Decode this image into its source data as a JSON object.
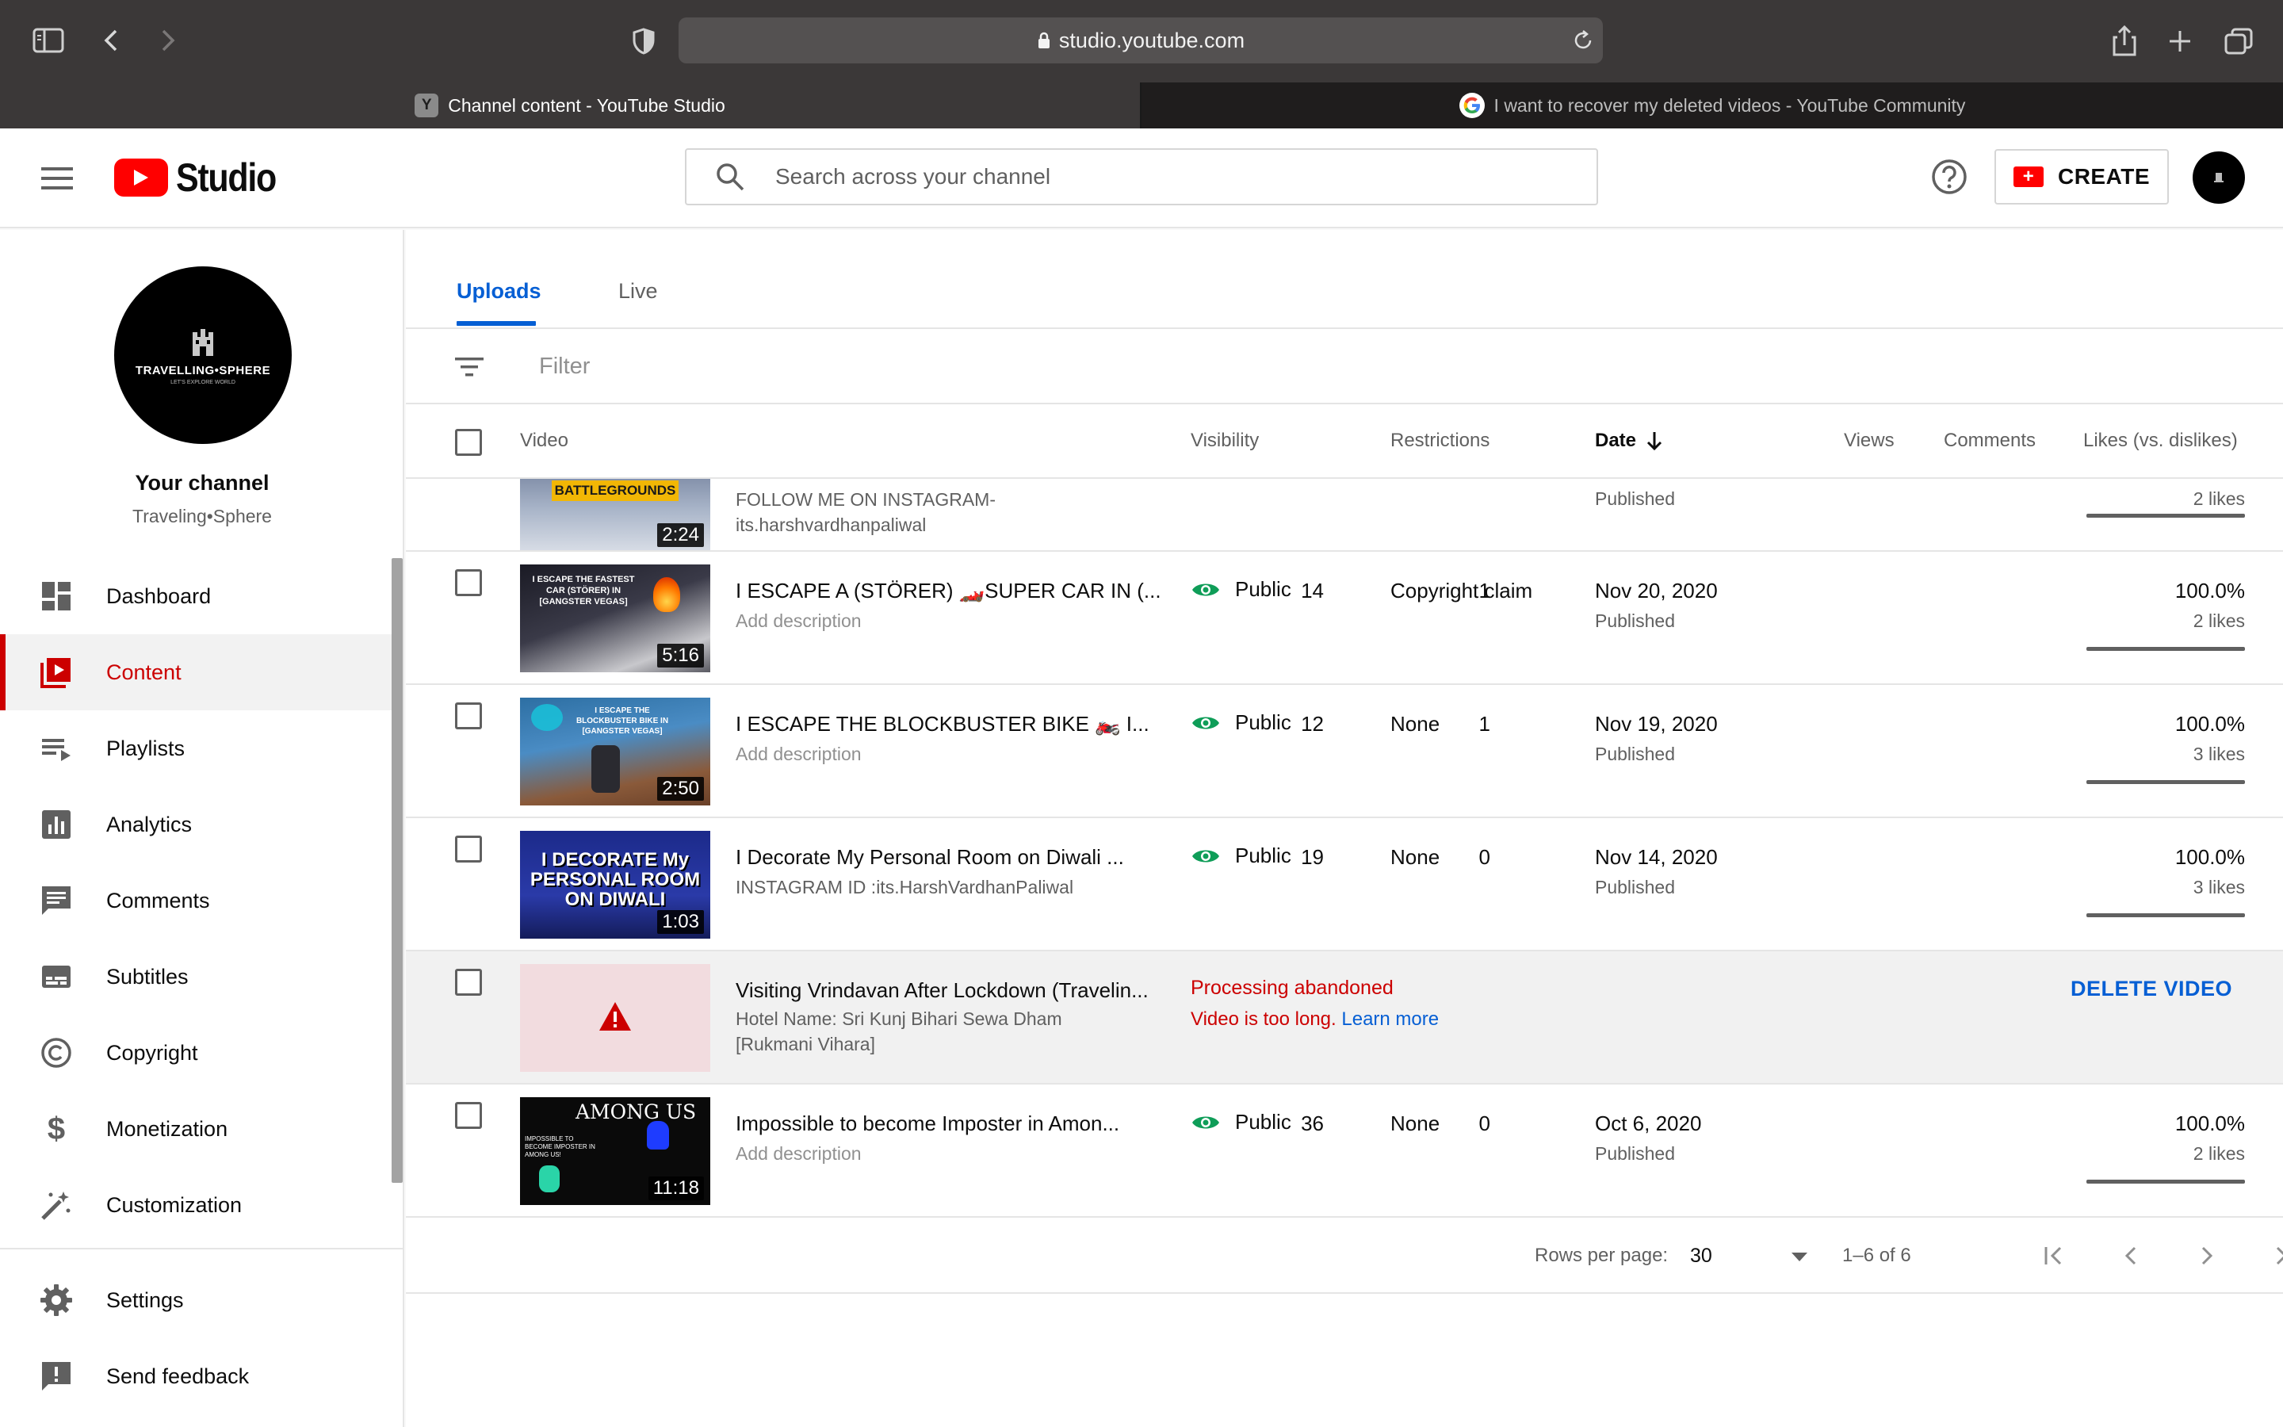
{
  "browser": {
    "url": "studio.youtube.com",
    "tabs": [
      {
        "title": "Channel content - YouTube Studio",
        "favicon_letter": "Y"
      },
      {
        "title": "I want to recover my deleted videos - YouTube Community"
      }
    ]
  },
  "header": {
    "logo_text": "Studio",
    "search_placeholder": "Search across your channel",
    "create_label": "CREATE"
  },
  "sidebar": {
    "avatar_brand": "TRAVELLING•SPHERE",
    "avatar_tagline": "LET'S EXPLORE WORLD",
    "your_channel_label": "Your channel",
    "channel_name": "Traveling•Sphere",
    "items": [
      {
        "label": "Dashboard",
        "icon": "dashboard-icon"
      },
      {
        "label": "Content",
        "icon": "content-icon",
        "active": true
      },
      {
        "label": "Playlists",
        "icon": "playlists-icon"
      },
      {
        "label": "Analytics",
        "icon": "analytics-icon"
      },
      {
        "label": "Comments",
        "icon": "comments-icon"
      },
      {
        "label": "Subtitles",
        "icon": "subtitles-icon"
      },
      {
        "label": "Copyright",
        "icon": "copyright-icon"
      },
      {
        "label": "Monetization",
        "icon": "monetization-icon"
      },
      {
        "label": "Customization",
        "icon": "customization-icon"
      },
      {
        "label": "Settings",
        "icon": "settings-icon"
      },
      {
        "label": "Send feedback",
        "icon": "feedback-icon"
      }
    ]
  },
  "content": {
    "tabs": [
      "Uploads",
      "Live"
    ],
    "filter_placeholder": "Filter",
    "columns": {
      "video": "Video",
      "visibility": "Visibility",
      "restrictions": "Restrictions",
      "date": "Date",
      "views": "Views",
      "comments": "Comments",
      "likes": "Likes (vs. dislikes)"
    },
    "rows": [
      {
        "title": "",
        "description": "FOLLOW ME ON INSTAGRAM- its.harshvardhanpaliwal",
        "duration": "2:24",
        "thumb_text": "BATTLEGROUNDS",
        "status": "Published",
        "likes_count": "2 likes",
        "likes_ratio": 1.0
      },
      {
        "title": "I ESCAPE A (STÖRER) 🏎️SUPER CAR IN (...",
        "description": "Add description",
        "duration": "5:16",
        "thumb_text": "I ESCAPE THE FASTEST CAR (STÖRER) IN [GANGSTER VEGAS]",
        "visibility": "Public",
        "restrictions": "Copyright claim",
        "date": "Nov 20, 2020",
        "status": "Published",
        "views": "14",
        "comments": "1",
        "likes_pct": "100.0%",
        "likes_count": "2 likes",
        "likes_ratio": 1.0
      },
      {
        "title": "I ESCAPE THE BLOCKBUSTER BIKE 🏍️ I...",
        "description": "Add description",
        "duration": "2:50",
        "thumb_text": "I ESCAPE THE BLOCKBUSTER BIKE IN [GANGSTER VEGAS]",
        "visibility": "Public",
        "restrictions": "None",
        "date": "Nov 19, 2020",
        "status": "Published",
        "views": "12",
        "comments": "1",
        "likes_pct": "100.0%",
        "likes_count": "3 likes",
        "likes_ratio": 1.0
      },
      {
        "title": "I Decorate My Personal Room on Diwali ...",
        "description": "INSTAGRAM ID :its.HarshVardhanPaliwal",
        "duration": "1:03",
        "thumb_text": "I DECORATE My PERSONAL ROOM ON DIWALI",
        "visibility": "Public",
        "restrictions": "None",
        "date": "Nov 14, 2020",
        "status": "Published",
        "views": "19",
        "comments": "0",
        "likes_pct": "100.0%",
        "likes_count": "3 likes",
        "likes_ratio": 1.0
      },
      {
        "title": "Visiting Vrindavan After Lockdown (Travelin...",
        "description_line1": "Hotel Name: Sri Kunj Bihari Sewa Dham",
        "description_line2": "[Rukmani Vihara]",
        "error_title": "Processing abandoned",
        "error_message": "Video is too long.",
        "learn_more": "Learn more",
        "action": "DELETE VIDEO"
      },
      {
        "title": "Impossible to become Imposter in Amon...",
        "description": "Add description",
        "duration": "11:18",
        "thumb_text": "AMONG US",
        "thumb_subtext": "IMPOSSIBLE TO BECOME IMPOSTER IN AMONG US!",
        "visibility": "Public",
        "restrictions": "None",
        "date": "Oct 6, 2020",
        "status": "Published",
        "views": "36",
        "comments": "0",
        "likes_pct": "100.0%",
        "likes_count": "2 likes",
        "likes_ratio": 1.0
      }
    ],
    "pagination": {
      "rows_per_page_label": "Rows per page:",
      "rows_per_page": "30",
      "range": "1–6 of 6"
    }
  },
  "colors": {
    "brand_red": "#ff0000",
    "active_red": "#cc0000",
    "link_blue": "#065fd4",
    "public_green": "#0f9d58"
  }
}
